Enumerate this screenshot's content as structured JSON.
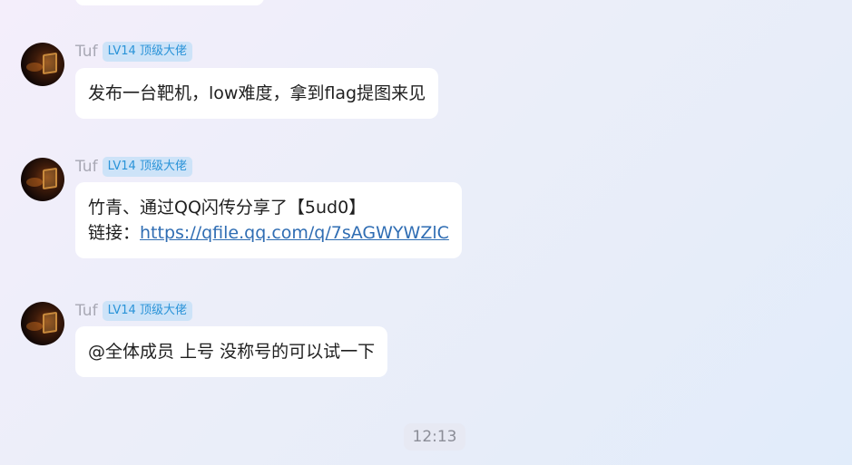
{
  "messages": [
    {
      "sender": "Tuf",
      "badge": "LV14 顶级大佬",
      "text": "发布一台靶机，low难度，拿到flag提图来见"
    },
    {
      "sender": "Tuf",
      "badge": "LV14 顶级大佬",
      "line1": "竹青、通过QQ闪传分享了【5ud0】",
      "link_prefix": "链接：",
      "link_text": "https://qfile.qq.com/q/7sAGWYWZlC"
    },
    {
      "sender": "Tuf",
      "badge": "LV14 顶级大佬",
      "text": "@全体成员 上号 没称号的可以试一下"
    }
  ],
  "timestamp": "12:13",
  "colors": {
    "badge_text": "#2a93d8",
    "badge_bg": "#cde3f8",
    "link": "#2f6db3",
    "sender": "#a8a8b4"
  }
}
